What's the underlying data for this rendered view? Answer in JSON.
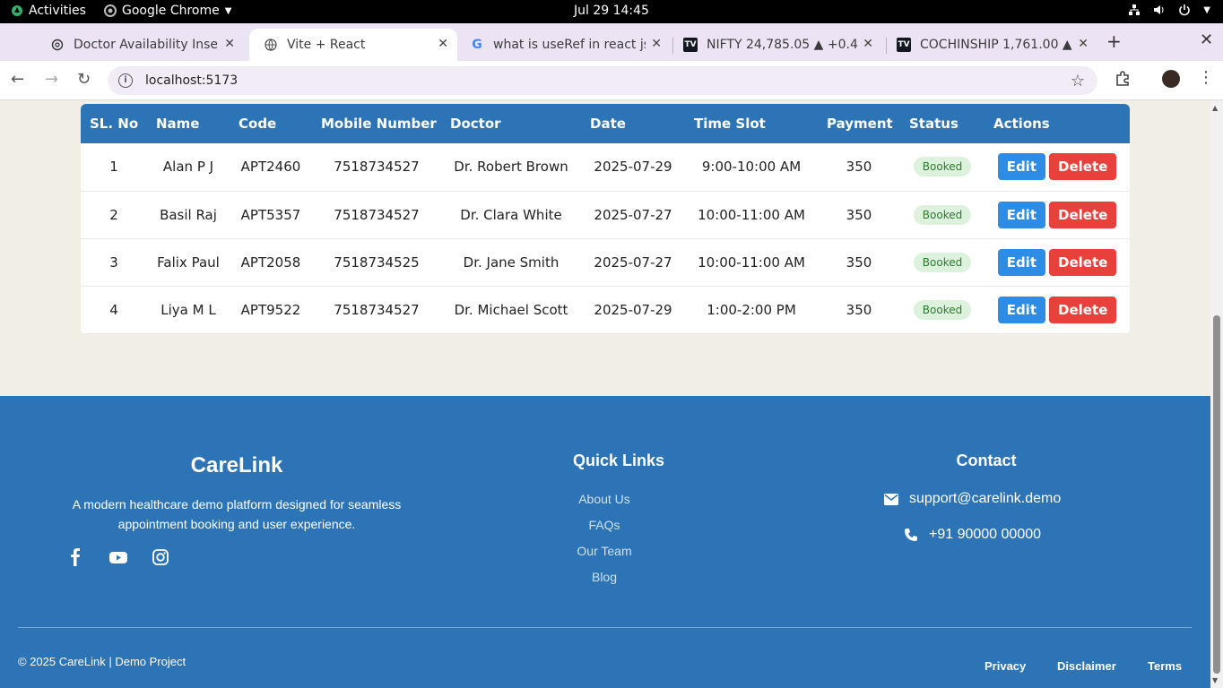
{
  "system": {
    "activities": "Activities",
    "app_name": "Google Chrome",
    "clock": "Jul 29  14:45"
  },
  "browser": {
    "tabs": [
      {
        "title": "Doctor Availability Insert",
        "icon": "openai-icon"
      },
      {
        "title": "Vite + React",
        "icon": "globe-icon"
      },
      {
        "title": "what is useRef in react js",
        "icon": "google-icon"
      },
      {
        "title": "NIFTY 24,785.05 ▲ +0.4",
        "icon": "tradingview-icon"
      },
      {
        "title": "COCHINSHIP 1,761.00 ▲",
        "icon": "tradingview-icon"
      }
    ],
    "url": "localhost:5173"
  },
  "table": {
    "headers": [
      "SL. No",
      "Name",
      "Code",
      "Mobile Number",
      "Doctor",
      "Date",
      "Time Slot",
      "Payment",
      "Status",
      "Actions"
    ],
    "rows": [
      {
        "sl": "1",
        "name": "Alan P J",
        "code": "APT2460",
        "mobile": "7518734527",
        "doctor": "Dr. Robert Brown",
        "date": "2025-07-29",
        "slot": "9:00-10:00 AM",
        "payment": "350",
        "status": "Booked"
      },
      {
        "sl": "2",
        "name": "Basil Raj",
        "code": "APT5357",
        "mobile": "7518734527",
        "doctor": "Dr. Clara White",
        "date": "2025-07-27",
        "slot": "10:00-11:00 AM",
        "payment": "350",
        "status": "Booked"
      },
      {
        "sl": "3",
        "name": "Falix Paul",
        "code": "APT2058",
        "mobile": "7518734525",
        "doctor": "Dr. Jane Smith",
        "date": "2025-07-27",
        "slot": "10:00-11:00 AM",
        "payment": "350",
        "status": "Booked"
      },
      {
        "sl": "4",
        "name": "Liya M L",
        "code": "APT9522",
        "mobile": "7518734527",
        "doctor": "Dr. Michael Scott",
        "date": "2025-07-29",
        "slot": "1:00-2:00 PM",
        "payment": "350",
        "status": "Booked"
      }
    ],
    "edit_label": "Edit",
    "delete_label": "Delete"
  },
  "footer": {
    "brand": "CareLink",
    "tagline": "A modern healthcare demo platform designed for seamless appointment booking and user experience.",
    "quick_links_title": "Quick Links",
    "quick_links": [
      "About Us",
      "FAQs",
      "Our Team",
      "Blog"
    ],
    "contact_title": "Contact",
    "email": "support@carelink.demo",
    "phone": "+91 90000 00000",
    "copyright": "© 2025 CareLink | Demo Project",
    "bottom_links": [
      "Privacy",
      "Disclaimer",
      "Terms"
    ]
  },
  "colors": {
    "primary": "#2c74b5",
    "edit": "#2d8ce6",
    "delete": "#e8403a",
    "badge_bg": "#dcf2dd",
    "page_bg": "#f1eee6"
  }
}
